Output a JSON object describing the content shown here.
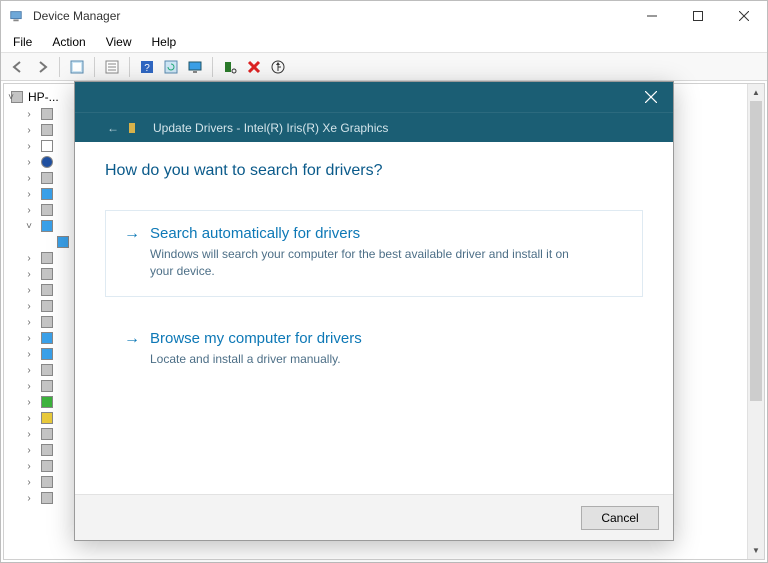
{
  "window": {
    "title": "Device Manager"
  },
  "menubar": [
    "File",
    "Action",
    "View",
    "Help"
  ],
  "toolbar": {
    "buttons": [
      "back-icon",
      "forward-icon",
      "sep",
      "show-hidden-icon",
      "sep",
      "properties-icon",
      "sep",
      "help-icon",
      "refresh-icon",
      "monitor-icon",
      "sep",
      "hardware-scan-icon",
      "uninstall-icon",
      "update-icon"
    ]
  },
  "tree": {
    "root": "HP-...",
    "items": [
      {
        "icon": "audio",
        "expander": ">"
      },
      {
        "icon": "audio",
        "expander": ">"
      },
      {
        "icon": "battery",
        "expander": ">"
      },
      {
        "icon": "bluetooth",
        "expander": ">"
      },
      {
        "icon": "camera",
        "expander": ">"
      },
      {
        "icon": "computer",
        "expander": ">"
      },
      {
        "icon": "disk",
        "expander": ">"
      },
      {
        "icon": "display",
        "expander": "v"
      },
      {
        "icon": "device",
        "expander": " "
      },
      {
        "icon": "firmware",
        "expander": ">"
      },
      {
        "icon": "hid",
        "expander": ">"
      },
      {
        "icon": "ide",
        "expander": ">"
      },
      {
        "icon": "keyboard",
        "expander": ">"
      },
      {
        "icon": "mouse",
        "expander": ">"
      },
      {
        "icon": "monitor",
        "expander": ">"
      },
      {
        "icon": "network",
        "expander": ">"
      },
      {
        "icon": "ports",
        "expander": ">"
      },
      {
        "icon": "print",
        "expander": ">"
      },
      {
        "icon": "processor",
        "expander": ">"
      },
      {
        "icon": "security",
        "expander": ">"
      },
      {
        "icon": "software",
        "expander": ">"
      },
      {
        "icon": "sound",
        "expander": ">"
      },
      {
        "icon": "storage",
        "expander": ">"
      },
      {
        "icon": "system",
        "expander": ">"
      },
      {
        "icon": "usb",
        "expander": ">"
      }
    ]
  },
  "dialog": {
    "subtitle_arrow": "←",
    "subtitle": "Update Drivers - Intel(R) Iris(R) Xe Graphics",
    "heading": "How do you want to search for drivers?",
    "options": [
      {
        "arrow": "→",
        "title": "Search automatically for drivers",
        "desc": "Windows will search your computer for the best available driver and install it on your device."
      },
      {
        "arrow": "→",
        "title": "Browse my computer for drivers",
        "desc": "Locate and install a driver manually."
      }
    ],
    "cancel": "Cancel"
  }
}
